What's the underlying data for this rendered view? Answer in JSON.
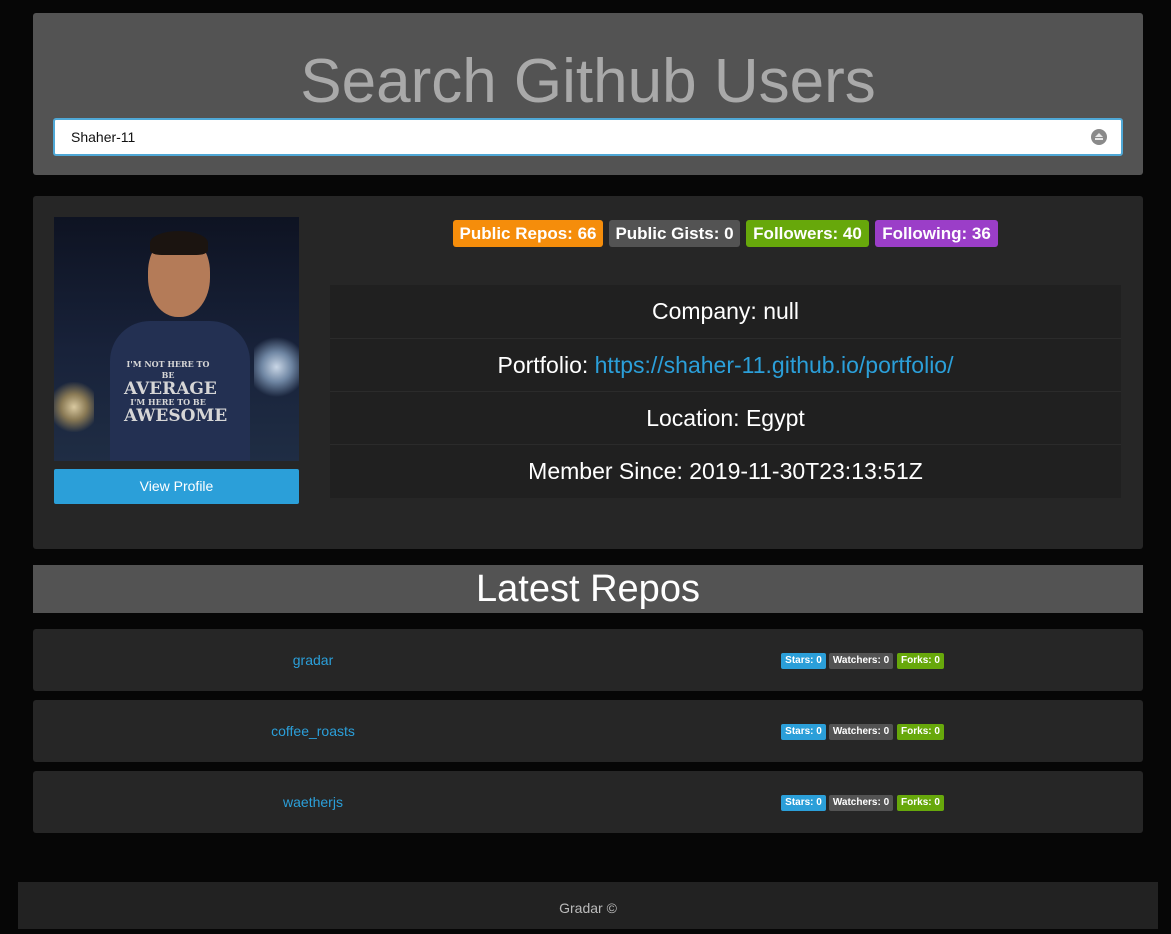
{
  "search": {
    "title": "Search Github Users",
    "value": "Shaher-11",
    "clear_icon": "clear-circle-icon"
  },
  "profile": {
    "avatar_alt": "Github user avatar",
    "avatar_shirt_text": [
      "I'M NOT HERE TO BE",
      "AVERAGE",
      "I'M HERE TO BE",
      "AWESOME"
    ],
    "view_profile_label": "View Profile",
    "badges": [
      {
        "label": "Public Repos: 66",
        "color": "#f58d0b"
      },
      {
        "label": "Public Gists: 0",
        "color": "#535353"
      },
      {
        "label": "Followers: 40",
        "color": "#67a80b"
      },
      {
        "label": "Following: 36",
        "color": "#9b3ec8"
      }
    ],
    "info": {
      "company": "Company: null",
      "portfolio_label": "Portfolio: ",
      "portfolio_url": "https://shaher-11.github.io/portfolio/",
      "location": "Location: Egypt",
      "member_since": "Member Since: 2019-11-30T23:13:51Z"
    }
  },
  "repos": {
    "header": "Latest Repos",
    "items": [
      {
        "name": "gradar",
        "stars": "Stars: 0",
        "watchers": "Watchers: 0",
        "forks": "Forks: 0"
      },
      {
        "name": "coffee_roasts",
        "stars": "Stars: 0",
        "watchers": "Watchers: 0",
        "forks": "Forks: 0"
      },
      {
        "name": "waetherjs",
        "stars": "Stars: 0",
        "watchers": "Watchers: 0",
        "forks": "Forks: 0"
      }
    ],
    "badge_colors": {
      "stars": "#2b9fd9",
      "watchers": "#535353",
      "forks": "#67a80b"
    }
  },
  "footer": {
    "text": "Gradar ©"
  }
}
